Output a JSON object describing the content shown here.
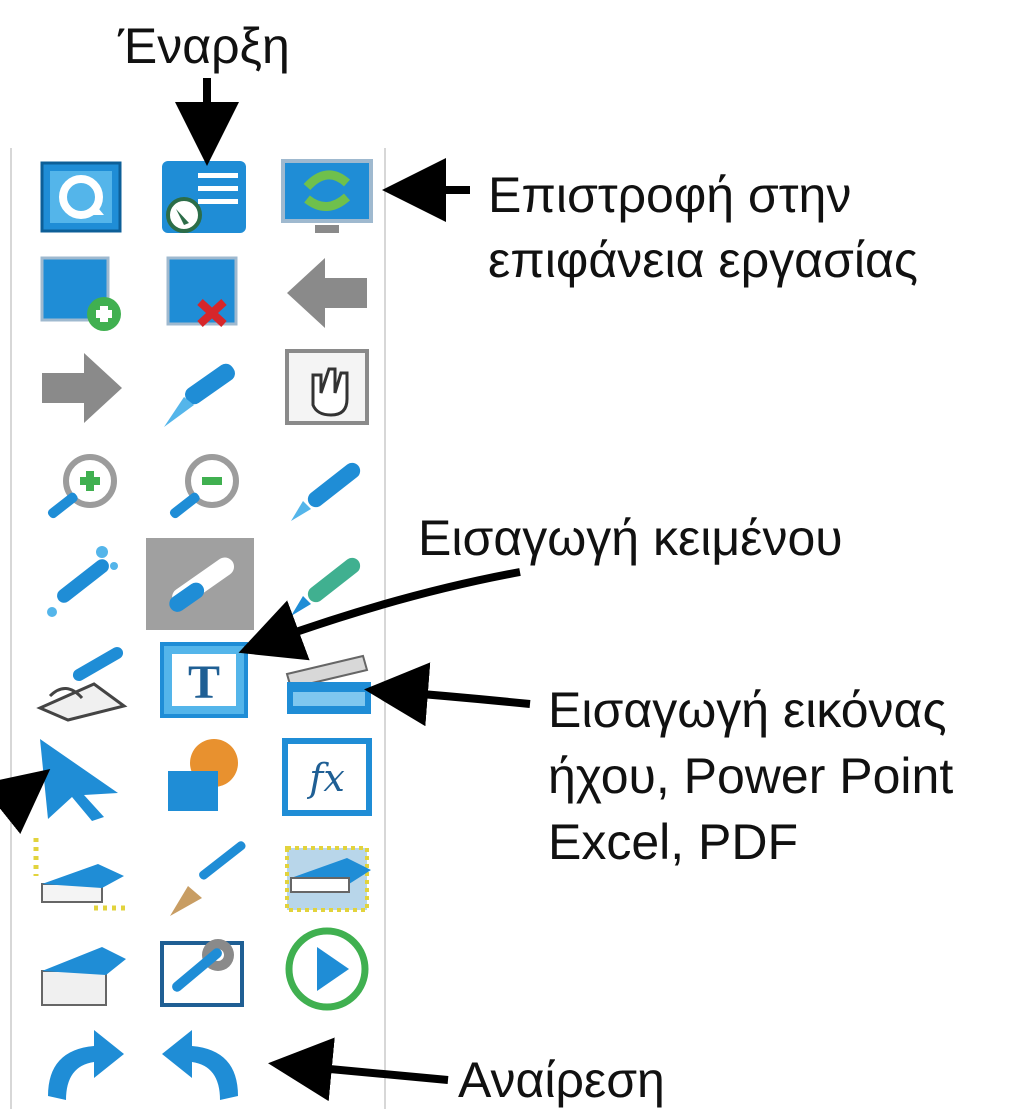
{
  "annotations": {
    "start": "Έναρξη",
    "desktop_line1": "Επιστροφή στην",
    "desktop_line2": "επιφάνεια εργασίας",
    "text_insert": "Εισαγωγή κειμένου",
    "media_line1": "Εισαγωγή εικόνας",
    "media_line2": "ήχου, Power Point",
    "media_line3": "Excel, PDF",
    "undo": "Αναίρεση"
  },
  "toolbar": {
    "rows": 10,
    "columns": 3,
    "icons": [
      "refresh-icon",
      "start-menu-icon",
      "return-desktop-icon",
      "new-page-icon",
      "delete-page-icon",
      "previous-page-icon",
      "next-page-icon",
      "laser-pointer-icon",
      "hand-pan-icon",
      "zoom-in-icon",
      "zoom-out-icon",
      "pen-icon",
      "magic-pen-icon",
      "selected-pen-icon",
      "highlighter-icon",
      "handwriting-icon",
      "text-insert-icon",
      "media-insert-icon",
      "select-arrow-icon",
      "shapes-icon",
      "formula-icon",
      "eraser-dotted-icon",
      "brush-icon",
      "area-eraser-icon",
      "clear-page-icon",
      "settings-tools-icon",
      "play-icon",
      "redo-icon",
      "undo-icon"
    ]
  },
  "colors": {
    "accent": "#1f8dd6",
    "icon_gray": "#8a8a8a",
    "green": "#40b050",
    "red": "#d6262a",
    "orange": "#e8912f"
  }
}
